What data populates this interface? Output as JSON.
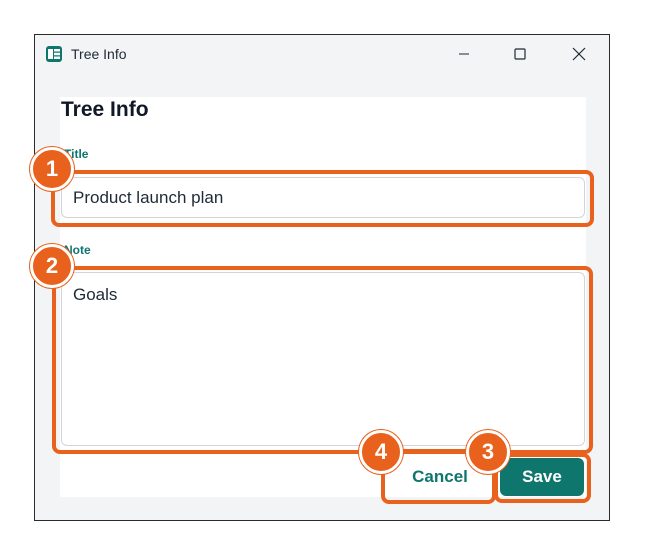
{
  "window": {
    "title": "Tree Info",
    "app_icon": "tree-app-icon",
    "controls": [
      "minimize-icon",
      "maximize-icon",
      "close-icon"
    ]
  },
  "dialog": {
    "heading": "Tree Info",
    "title_field": {
      "label": "Title",
      "value": "Product launch plan"
    },
    "note_field": {
      "label": "Note",
      "value": "Goals"
    },
    "cancel_label": "Cancel",
    "save_label": "Save"
  },
  "annotations": {
    "marker_1": "1",
    "marker_2": "2",
    "marker_3": "3",
    "marker_4": "4"
  },
  "colors": {
    "accent": "#0f766e",
    "annotation": "#e8621d"
  }
}
